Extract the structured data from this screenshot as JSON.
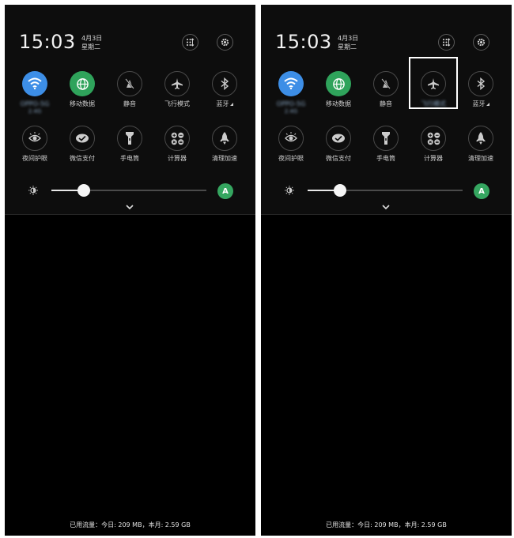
{
  "header": {
    "time": "15:03",
    "date": "4月3日",
    "weekday": "星期二"
  },
  "tiles_row1": [
    {
      "label": "OPPO-5G",
      "sub": "2.4G",
      "icon": "wifi-icon",
      "state": "on-blue"
    },
    {
      "label": "移动数据",
      "icon": "globe-icon",
      "state": "on-green"
    },
    {
      "label": "静音",
      "icon": "mute-icon",
      "state": "off"
    },
    {
      "label": "飞行模式",
      "icon": "airplane-icon",
      "state": "off"
    },
    {
      "label": "蓝牙",
      "icon": "bluetooth-icon",
      "state": "off"
    }
  ],
  "tiles_row2": [
    {
      "label": "夜间护眼",
      "icon": "night-eye-icon"
    },
    {
      "label": "微信支付",
      "icon": "wechat-pay-icon"
    },
    {
      "label": "手电筒",
      "icon": "flashlight-icon"
    },
    {
      "label": "计算器",
      "icon": "calculator-icon"
    },
    {
      "label": "清理加速",
      "icon": "rocket-icon"
    }
  ],
  "brightness": {
    "level_percent": 21,
    "auto_label": "A"
  },
  "footer_text": "已用流量：今日: 209 MB，本月: 2.59 GB",
  "colors": {
    "wifi_on": "#3d8ee6",
    "data_on": "#2fa35b",
    "auto": "#35a660",
    "highlight": "#ffffff"
  }
}
